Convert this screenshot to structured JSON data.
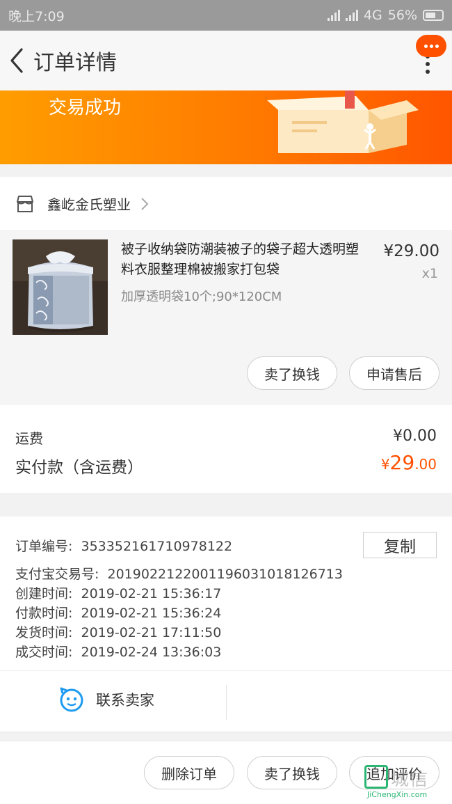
{
  "status_bar": {
    "time": "晚上7:09",
    "network": "4G",
    "battery": "56%"
  },
  "nav": {
    "title": "订单详情"
  },
  "banner": {
    "title": "交易成功"
  },
  "store": {
    "name": "鑫屹金氏塑业"
  },
  "product": {
    "title": "被子收纳袋防潮装被子的袋子超大透明塑料衣服整理棉被搬家打包袋",
    "spec": "加厚透明袋10个;90*120CM",
    "price": "¥29.00",
    "qty": "x1",
    "sell_button": "卖了换钱",
    "after_sale_button": "申请售后"
  },
  "fees": {
    "shipping_label": "运费",
    "shipping_value": "¥0.00",
    "paid_label": "实付款（含运费）",
    "paid_currency": "¥",
    "paid_int": "29",
    "paid_dec": ".00"
  },
  "order_info": {
    "copy_button": "复制",
    "rows": [
      {
        "label": "订单编号:",
        "value": "353352161710978122"
      },
      {
        "label": "支付宝交易号:",
        "value": "2019022122001196031018126713"
      },
      {
        "label": "创建时间:",
        "value": "2019-02-21 15:36:17"
      },
      {
        "label": "付款时间:",
        "value": "2019-02-21 15:36:24"
      },
      {
        "label": "发货时间:",
        "value": "2019-02-21 17:11:50"
      },
      {
        "label": "成交时间:",
        "value": "2019-02-24 13:36:03"
      }
    ]
  },
  "contact": {
    "label": "联系卖家"
  },
  "bottom": {
    "delete_button": "删除订单",
    "sell_button": "卖了换钱",
    "review_button": "追加评价"
  },
  "watermark": {
    "text": "城信",
    "url": "JiChengXin.com"
  },
  "colors": {
    "accent": "#ff5000",
    "banner_start": "#ff9d00",
    "contact_icon": "#1e9bf0"
  }
}
